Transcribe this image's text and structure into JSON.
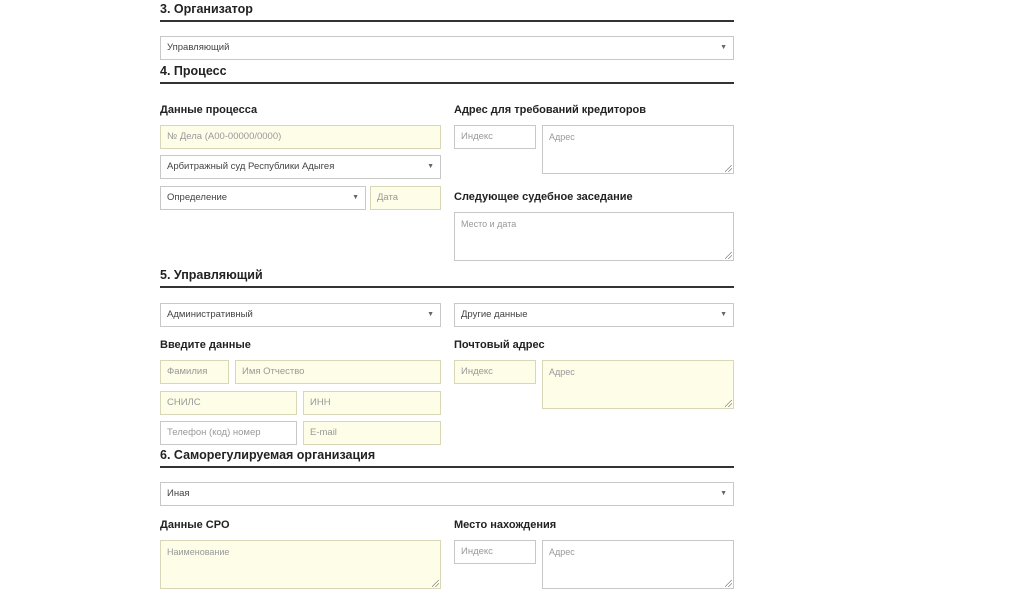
{
  "sections": {
    "organizer": {
      "title": "3. Организатор",
      "select_value": "Управляющий"
    },
    "process": {
      "title": "4. Процесс",
      "process_data_label": "Данные процесса",
      "case_number_placeholder": "№ Дела (А00-00000/0000)",
      "court_select_value": "Арбитражный суд Республики Адыгея",
      "act_select_value": "Определение",
      "date_placeholder": "Дата",
      "creditors_address_label": "Адрес для требований кредиторов",
      "index_placeholder": "Индекс",
      "address_placeholder": "Адрес",
      "next_hearing_label": "Следующее судебное заседание",
      "place_date_placeholder": "Место и дата"
    },
    "manager": {
      "title": "5. Управляющий",
      "type_select_value": "Административный",
      "other_select_value": "Другие данные",
      "enter_data_label": "Введите данные",
      "surname_placeholder": "Фамилия",
      "name_placeholder": "Имя Отчество",
      "snils_placeholder": "СНИЛС",
      "inn_placeholder": "ИНН",
      "phone_placeholder": "Телефон (код) номер",
      "email_placeholder": "E-mail",
      "postal_label": "Почтовый адрес",
      "index_placeholder": "Индекс",
      "address_placeholder": "Адрес"
    },
    "sro": {
      "title": "6. Саморегулируемая организация",
      "select_value": "Иная",
      "sro_data_label": "Данные СРО",
      "name_placeholder": "Наименование",
      "location_label": "Место нахождения",
      "index_placeholder": "Индекс",
      "address_placeholder": "Адрес"
    }
  },
  "icons": {
    "caret": "▼"
  }
}
